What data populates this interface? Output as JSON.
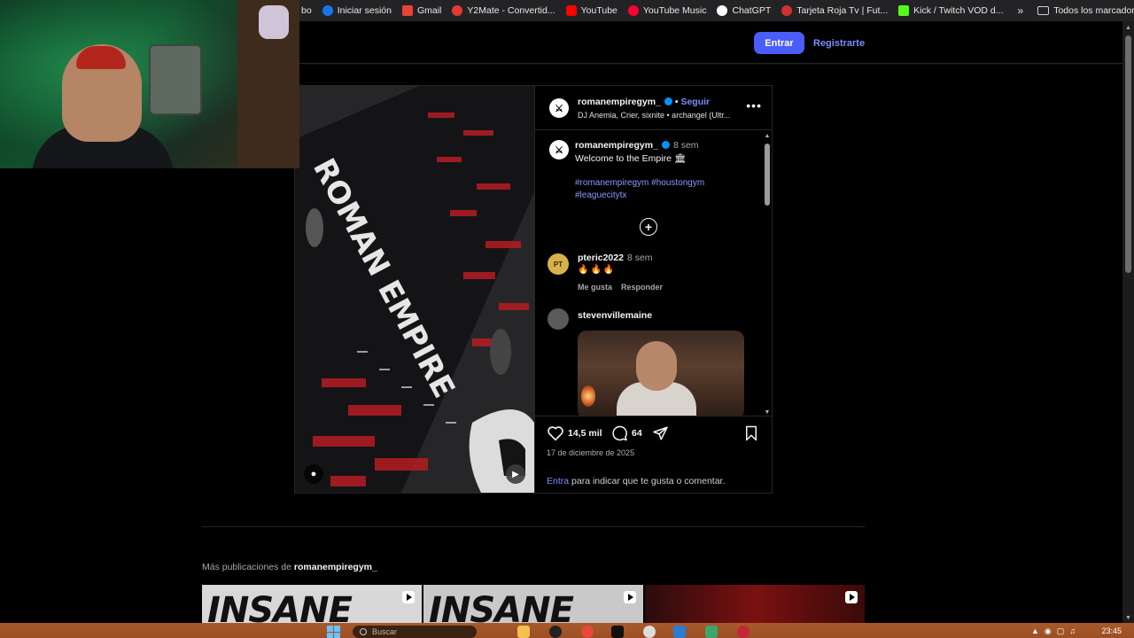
{
  "bookmarks": {
    "items": [
      {
        "label": "bo",
        "icon": "bookmark-partial-icon",
        "color": "#888888"
      },
      {
        "label": "Iniciar sesión",
        "icon": "login-icon",
        "color": "#1a73e8"
      },
      {
        "label": "Gmail",
        "icon": "gmail-icon",
        "color": "#ea4335"
      },
      {
        "label": "Y2Mate - Convertid...",
        "icon": "y2mate-icon",
        "color": "#e53935"
      },
      {
        "label": "YouTube",
        "icon": "youtube-icon",
        "color": "#ff0000"
      },
      {
        "label": "YouTube Music",
        "icon": "youtube-music-icon",
        "color": "#ff0033"
      },
      {
        "label": "ChatGPT",
        "icon": "chatgpt-icon",
        "color": "#ffffff"
      },
      {
        "label": "Tarjeta Roja Tv | Fut...",
        "icon": "tarjeta-roja-icon",
        "color": "#d32f2f"
      },
      {
        "label": "Kick / Twitch VOD d...",
        "icon": "kick-icon",
        "color": "#53fc18"
      }
    ],
    "more": "»",
    "all": "Todos los marcadores"
  },
  "header": {
    "login_label": "Entrar",
    "signup_label": "Registrarte"
  },
  "post": {
    "username": "romanempiregym_",
    "follow_sep": " • ",
    "follow_label": "Seguir",
    "audio": "DJ Anemia, Crier, sixnite • archangel (Ultr...",
    "more_label": "•••",
    "caption": {
      "username": "romanempiregym_",
      "time": "8 sem",
      "text": "Welcome to the Empire 🏛",
      "hashtags": "#romanempiregym #houstongym #leaguecitytx"
    },
    "add_label": "+",
    "comments": [
      {
        "username": "pteric2022",
        "time": "8 sem",
        "text": "🔥🔥🔥",
        "like_label": "Me gusta",
        "reply_label": "Responder",
        "avatar_color": "#d7b24a",
        "avatar_text": "PT"
      },
      {
        "username": "stevenvillemaine",
        "avatar_color": "#5a5a5a"
      }
    ],
    "likes": "14,5 mil",
    "comments_count": "64",
    "date": "17 de diciembre de 2025",
    "login_link": "Entra",
    "login_hint": " para indicar que te gusta o comentar."
  },
  "more_posts": {
    "prefix": "Más publicaciones de ",
    "username": "romanempiregym_",
    "thumbs": [
      {
        "text": "INSANE",
        "bg": "#d8d8d8"
      },
      {
        "text": "INSANE",
        "bg": "#c9c9c9"
      },
      {
        "text": "",
        "bg": "#7b1010"
      }
    ]
  },
  "taskbar": {
    "search_placeholder": "Buscar",
    "clock": "23:45"
  }
}
